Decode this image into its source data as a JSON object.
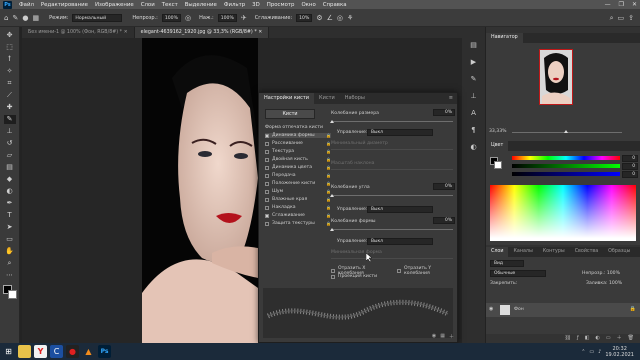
{
  "menubar": {
    "logo": "Ps",
    "items": [
      "Файл",
      "Редактирование",
      "Изображение",
      "Слои",
      "Текст",
      "Выделение",
      "Фильтр",
      "3D",
      "Просмотр",
      "Окно",
      "Справка"
    ],
    "window_buttons": [
      "—",
      "❐",
      "✕"
    ]
  },
  "options": {
    "mode_label": "Режим:",
    "mode_value": "Нормальный",
    "opacity_label": "Непрозр.:",
    "opacity_value": "100%",
    "pressure_label": "Наж.:",
    "pressure_value": "100%",
    "smoothing_label": "Сглаживание:",
    "smoothing_value": "10%"
  },
  "tabs": [
    {
      "label": "Без имени-1 @ 100% (Фон, RGB/8#) *",
      "active": false
    },
    {
      "label": "elegant-4639162_1920.jpg @ 33,3% (RGB/8#) *",
      "active": true
    }
  ],
  "tools": [
    "move-icon",
    "marquee-icon",
    "lasso-icon",
    "quick-select-icon",
    "crop-icon",
    "eyedropper-icon",
    "healing-icon",
    "brush-icon",
    "stamp-icon",
    "history-brush-icon",
    "eraser-icon",
    "gradient-icon",
    "blur-icon",
    "dodge-icon",
    "pen-icon",
    "type-icon",
    "path-select-icon",
    "shape-icon",
    "hand-icon",
    "zoom-icon"
  ],
  "navigator": {
    "title": "Навигатор",
    "zoom": "33,33%"
  },
  "color": {
    "title": "Цвет",
    "values": [
      "0",
      "0",
      "0"
    ]
  },
  "layers": {
    "tabs": [
      "Слои",
      "Каналы",
      "Контуры",
      "Свойства",
      "Образцы"
    ],
    "filter_label": "Вид",
    "blend": "Обычные",
    "opacity": "Непрозр.: 100%",
    "lock_label": "Закрепить:",
    "fill": "Заливка: 100%",
    "layer_name": "Фон"
  },
  "brush_panel": {
    "tabs": [
      "Настройки кисти",
      "Кисти",
      "Наборы"
    ],
    "brushes_button": "Кисти",
    "tip_shape": "Форма отпечатка кисти",
    "options": [
      {
        "label": "Динамика формы",
        "checked": true
      },
      {
        "label": "Рассеивание",
        "checked": false
      },
      {
        "label": "Текстура",
        "checked": false
      },
      {
        "label": "Двойная кисть",
        "checked": false
      },
      {
        "label": "Динамика цвета",
        "checked": false
      },
      {
        "label": "Передача",
        "checked": false
      },
      {
        "label": "Положение кисти",
        "checked": false
      },
      {
        "label": "Шум",
        "checked": false
      },
      {
        "label": "Влажные края",
        "checked": false
      },
      {
        "label": "Накладка",
        "checked": false
      },
      {
        "label": "Сглаживание",
        "checked": true
      },
      {
        "label": "Защита текстуры",
        "checked": false
      }
    ],
    "size_jitter_label": "Колебание размера",
    "size_jitter_value": "0%",
    "control1_label": "Управление:",
    "control1_value": "Выкл",
    "min_diameter_label": "Минимальный диаметр",
    "tilt_scale_label": "Масштаб наклона",
    "angle_jitter_label": "Колебание угла",
    "angle_jitter_value": "0%",
    "control2_label": "Управление:",
    "control2_value": "Выкл",
    "roundness_jitter_label": "Колебание формы",
    "roundness_jitter_value": "0%",
    "control3_label": "Управление:",
    "control3_value": "Выкл",
    "min_roundness_label": "Минимальная форма",
    "flip_x_label": "Отразить X колебания",
    "flip_y_label": "Отразить Y колебания",
    "projection_label": "Проекция кисти"
  },
  "clock": {
    "time": "20:32",
    "date": "19.02.2021"
  }
}
